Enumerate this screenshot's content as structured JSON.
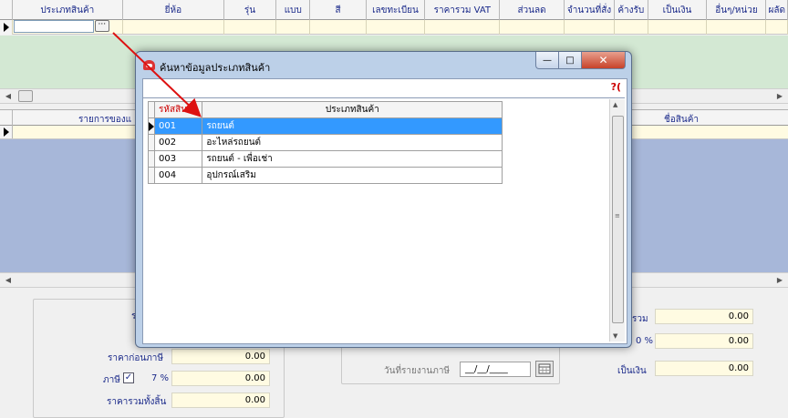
{
  "grid_top": {
    "columns": [
      {
        "label": "ประเภทสินค้า",
        "w": 123
      },
      {
        "label": "ยี่ห้อ",
        "w": 113
      },
      {
        "label": "รุ่น",
        "w": 58
      },
      {
        "label": "แบบ",
        "w": 38
      },
      {
        "label": "สี",
        "w": 62
      },
      {
        "label": "เลขทะเบียน",
        "w": 66
      },
      {
        "label": "ราคารวม VAT",
        "w": 83
      },
      {
        "label": "ส่วนลด",
        "w": 72
      },
      {
        "label": "จำนวนที่สั่ง",
        "w": 56
      },
      {
        "label": "ค้างรับ",
        "w": 37
      },
      {
        "label": "เป็นเงิน",
        "w": 66
      },
      {
        "label": "อื่นๆ/หน่วย",
        "w": 66
      },
      {
        "label": "ผลัด",
        "w": 24
      }
    ],
    "ellipsis_label": "···"
  },
  "grid_bottom": {
    "col1_label": "รายการของแ",
    "col2_label": "ชื่อสินค้า"
  },
  "dialog": {
    "title": "ค้นหาข้อมูลประเภทสินค้า",
    "minimize": "—",
    "maximize": "□",
    "close": "✕",
    "search_help": "?(",
    "headers": {
      "code": "รหัสสินค้า",
      "type": "ประเภทสินค้า"
    },
    "rows": [
      {
        "code": "001",
        "type": "รถยนต์"
      },
      {
        "code": "002",
        "type": "อะไหล่รถยนต์"
      },
      {
        "code": "003",
        "type": "รถยนต์ - เพื่อเช่า"
      },
      {
        "code": "004",
        "type": "อุปกรณ์เสริม"
      }
    ]
  },
  "summary_left": {
    "cut_label": "ร",
    "price_before_tax_label": "ราคาก่อนภาษี",
    "price_before_tax_value": "0.00",
    "tax_label": "ภาษี",
    "tax_checked": "✓",
    "tax_rate": "7 %",
    "tax_value": "0.00",
    "grand_total_label": "ราคารวมทั้งสิ้น",
    "grand_total_value": "0.00"
  },
  "summary_middle": {
    "tax_report_date_label": "วันที่รายงานภาษี",
    "tax_report_date_value": "__/__/____"
  },
  "summary_right": {
    "total_label_partial": "รวม",
    "total_value": "0.00",
    "percent_label": "0 %",
    "percent_value": "0.00",
    "amount_label": "เป็นเงิน",
    "amount_value": "0.00"
  },
  "colors": {
    "accent_red": "#dd1111",
    "selected_row": "#3399ff",
    "grid_yellow": "#fffbe2",
    "green_area": "#d3e8d3",
    "blue_area": "#a7b7d9"
  }
}
